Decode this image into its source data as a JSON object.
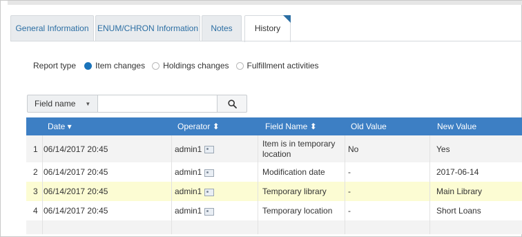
{
  "tabs": [
    {
      "label": "General Information",
      "active": false
    },
    {
      "label": "ENUM/CHRON Information",
      "active": false
    },
    {
      "label": "Notes",
      "active": false
    },
    {
      "label": "History",
      "active": true
    }
  ],
  "report": {
    "label": "Report type",
    "options": [
      {
        "label": "Item changes",
        "checked": true
      },
      {
        "label": "Holdings changes",
        "checked": false
      },
      {
        "label": "Fulfillment activities",
        "checked": false
      }
    ]
  },
  "filter": {
    "field_select": "Field name",
    "search_value": "",
    "search_icon": "search-icon"
  },
  "table": {
    "headers": {
      "date": "Date ▾",
      "operator": "Operator ⬍",
      "field_name": "Field Name ⬍",
      "old_value": "Old Value",
      "new_value": "New Value"
    },
    "rows": [
      {
        "num": "1",
        "date": "06/14/2017 20:45",
        "operator": "admin1",
        "field_name": "Item is in temporary location",
        "old_value": "No",
        "new_value": "Yes"
      },
      {
        "num": "2",
        "date": "06/14/2017 20:45",
        "operator": "admin1",
        "field_name": "Modification date",
        "old_value": "-",
        "new_value": "2017-06-14"
      },
      {
        "num": "3",
        "date": "06/14/2017 20:45",
        "operator": "admin1",
        "field_name": "Temporary library",
        "old_value": "-",
        "new_value": "Main Library"
      },
      {
        "num": "4",
        "date": "06/14/2017 20:45",
        "operator": "admin1",
        "field_name": "Temporary location",
        "old_value": "-",
        "new_value": "Short Loans"
      }
    ]
  },
  "colors": {
    "accent": "#3d7fc4",
    "tab_text": "#2b6ea3",
    "radio_checked": "#1a73ba",
    "highlight_row": "#fcfcd3"
  }
}
